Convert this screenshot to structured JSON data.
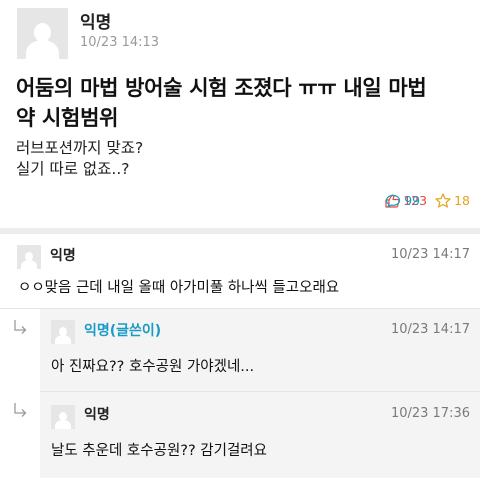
{
  "post": {
    "author": "익명",
    "date": "10/23 14:13",
    "title": "어둠의 마법 방어술 시험 조졌다 ㅠㅠ 내일 마법약 시험범위",
    "title_line1": "어둠의 마법 방어술 시험 조졌다 ㅠㅠ 내일 마법",
    "title_line2": "약 시험범위",
    "content_lines": [
      "러브포션까지 맞죠?",
      "실기 따로 없죠..?"
    ],
    "likes": "123",
    "comments": "99",
    "scraps": "18"
  },
  "icons": {
    "like": "thumbs-up-icon",
    "comment": "speech-bubble-icon",
    "scrap": "star-icon",
    "reply": "reply-arrow-icon",
    "avatar": "default-avatar-icon"
  },
  "colors": {
    "like": "#e24a3b",
    "comment": "#1a9bc7",
    "scrap": "#e3a41a",
    "writer_label": "#1a9bc7"
  },
  "comments": [
    {
      "author": "익명",
      "date": "10/23 14:17",
      "text": "ㅇㅇ맞음 근데 내일 올때 아가미풀 하나씩 들고오래요"
    },
    {
      "author": "익명(글쓴이)",
      "date": "10/23 14:17",
      "text": "아 진짜요?? 호수공원 가야겠네...",
      "is_reply": true
    },
    {
      "author": "익명",
      "date": "10/23 17:36",
      "text": "날도 추운데 호수공원?? 감기걸려요",
      "is_reply": true
    }
  ]
}
